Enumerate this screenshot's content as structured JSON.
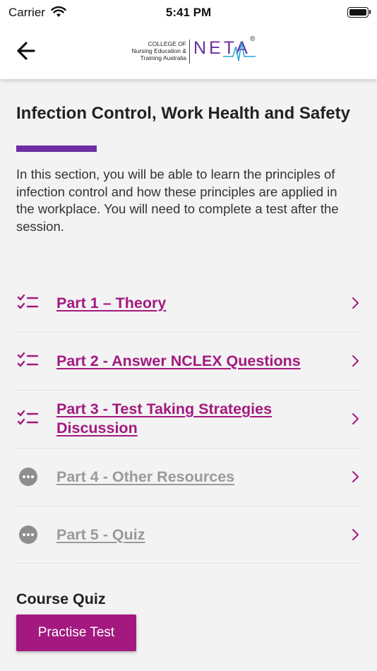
{
  "status_bar": {
    "carrier": "Carrier",
    "time": "5:41 PM"
  },
  "header": {
    "back_icon": "arrow-left-icon",
    "logo": {
      "line1": "COLLEGE OF",
      "line2": "Nursing Education &",
      "line3": "Training Australia",
      "brand": "NETA",
      "registered": "®"
    }
  },
  "content": {
    "title": "Infection Control, Work Health and Safety",
    "description": "In this section, you will be able to learn the principles of infection control and how these principles are applied in the workplace. You will need to complete a test after the session.",
    "parts": [
      {
        "label": "Part 1 – Theory",
        "state": "active",
        "icon": "checklist-icon"
      },
      {
        "label": "Part 2 - Answer NCLEX Questions",
        "state": "active",
        "icon": "checklist-icon"
      },
      {
        "label": "Part 3 - Test Taking Strategies Discussion",
        "state": "active",
        "icon": "checklist-icon"
      },
      {
        "label": "Part 4 - Other Resources",
        "state": "disabled",
        "icon": "more-icon"
      },
      {
        "label": "Part 5 - Quiz",
        "state": "disabled",
        "icon": "more-icon"
      }
    ],
    "course_quiz": {
      "heading": "Course Quiz",
      "button_label": "Practise Test"
    }
  },
  "colors": {
    "accent": "#a3197f",
    "underline": "#6d2fa3",
    "disabled": "#9a9a9a",
    "background": "#f3f3f3"
  }
}
